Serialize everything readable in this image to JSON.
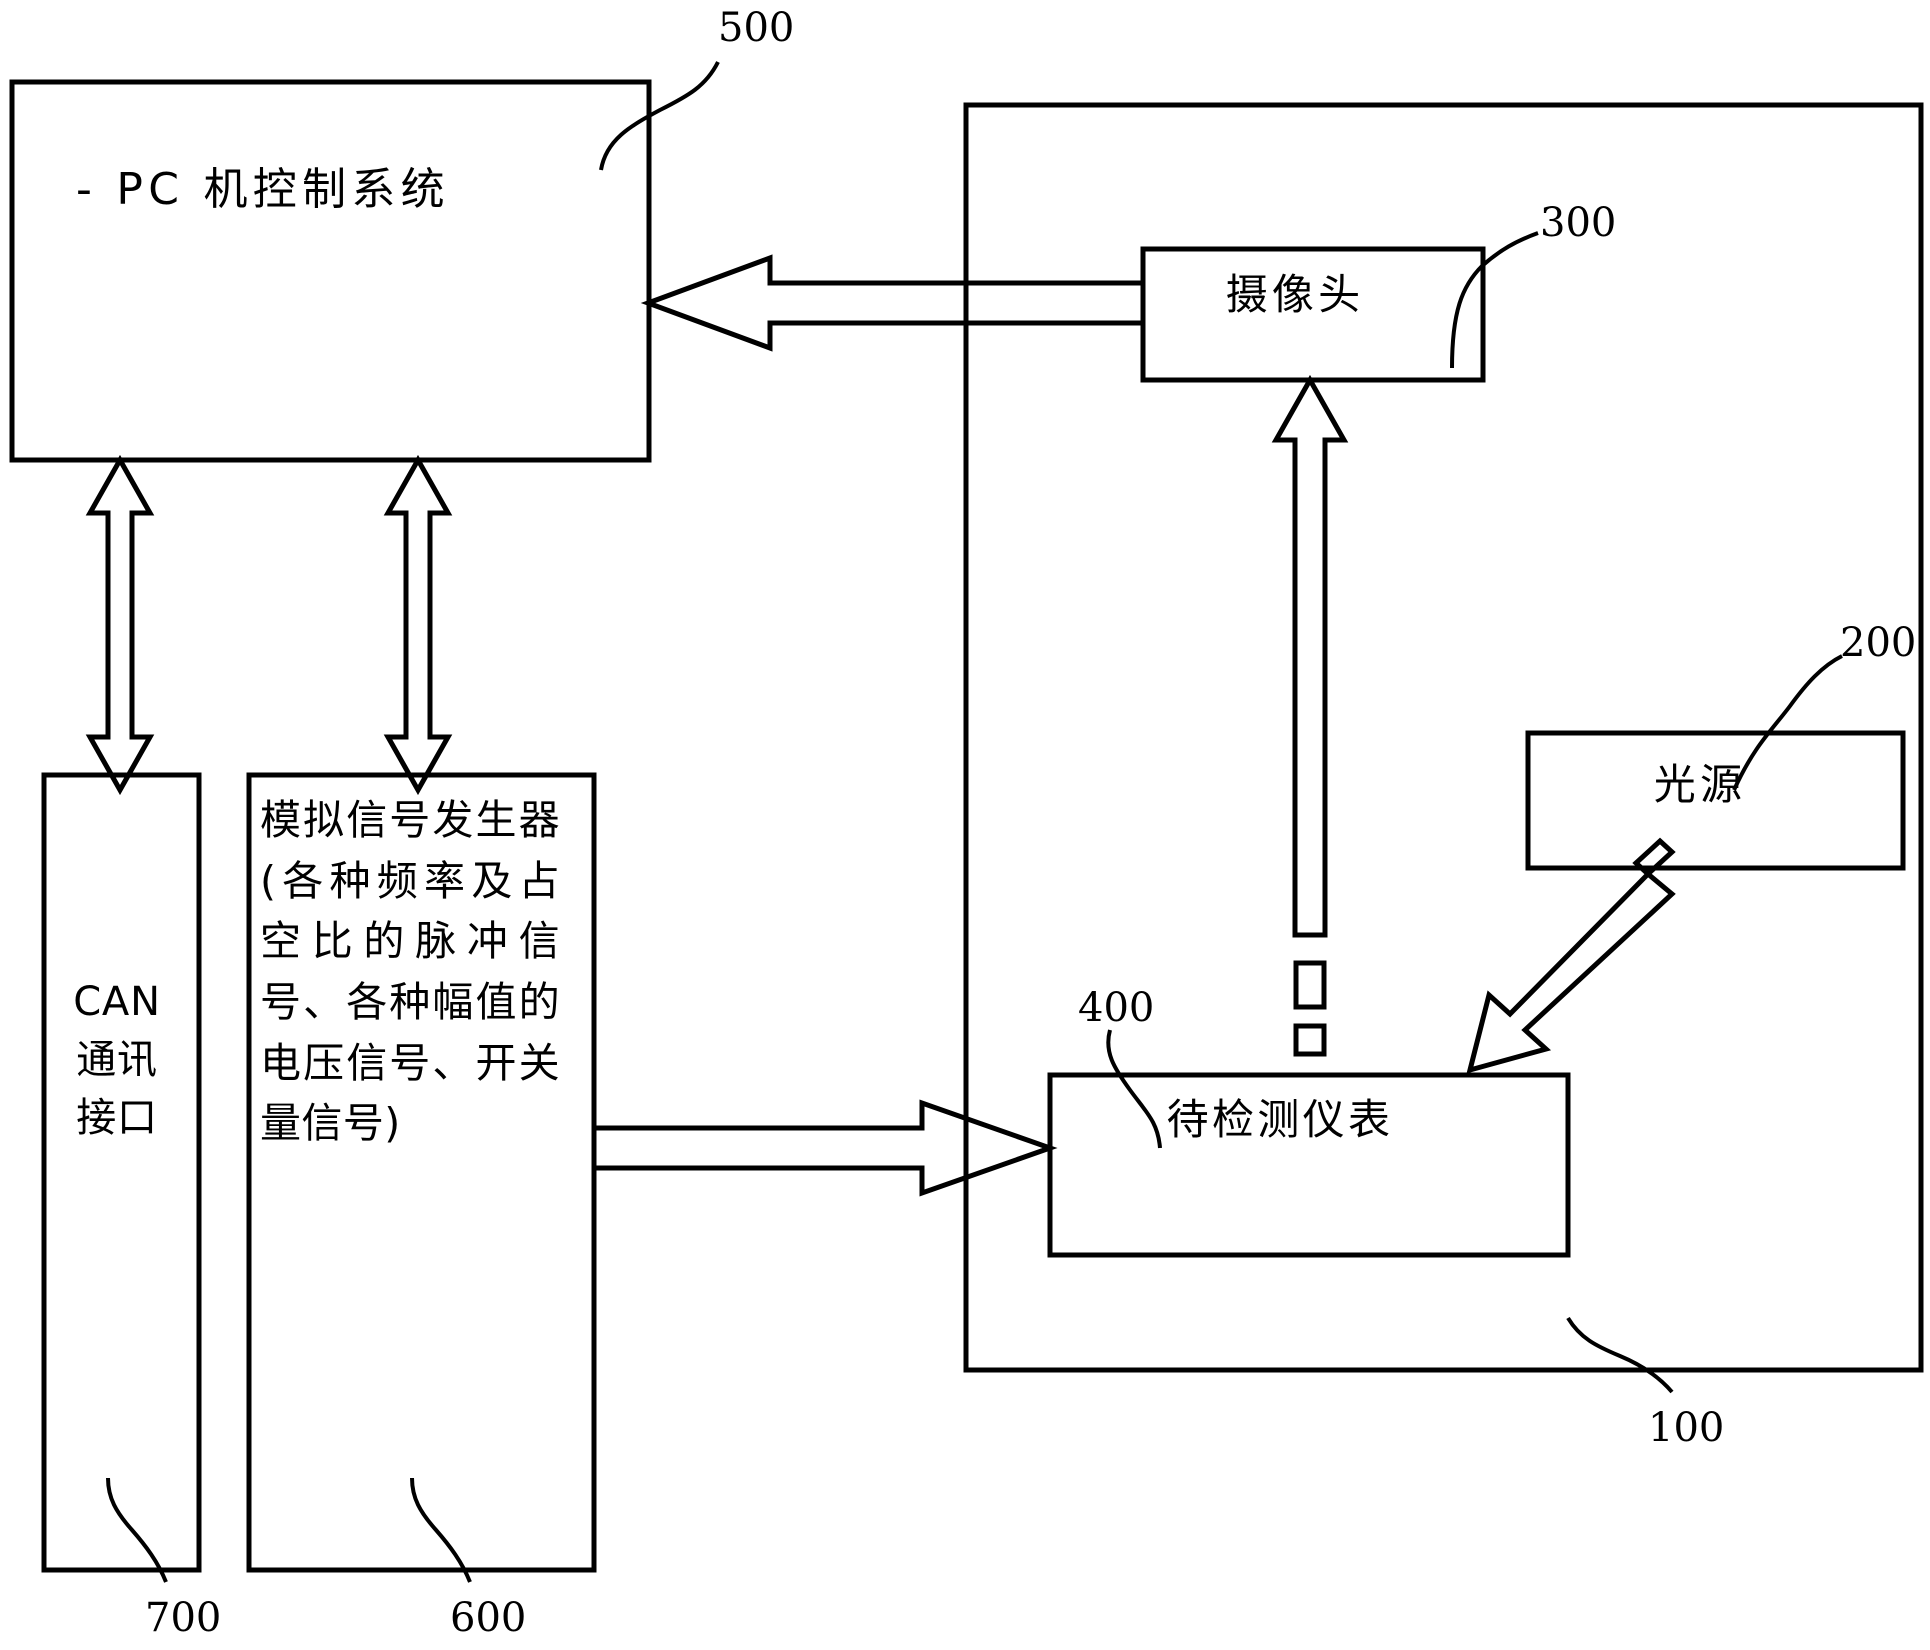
{
  "figure": {
    "type": "patent-block-diagram",
    "background_color": "#ffffff",
    "line_color": "#000000"
  },
  "blocks": {
    "pc_control_system": {
      "label": "- PC 机控制系统",
      "ref": "500"
    },
    "can_interface": {
      "line1": "CAN",
      "line2": "通讯",
      "line3": "接口",
      "ref": "700"
    },
    "signal_generator": {
      "label": "模拟信号发生器(各种频率及占空比的脉冲信号、各种幅值的电压信号、开关量信号)",
      "ref": "600"
    },
    "camera": {
      "label": "摄像头",
      "ref": "300"
    },
    "light_source": {
      "label": "光源",
      "ref": "200"
    },
    "meter_under_test": {
      "label": "待检测仪表",
      "ref": "400"
    },
    "enclosure": {
      "label": "",
      "ref": "100"
    }
  },
  "reference_numerals": [
    {
      "name": "pc-control-system",
      "value": "500"
    },
    {
      "name": "camera",
      "value": "300"
    },
    {
      "name": "light-source",
      "value": "200"
    },
    {
      "name": "meter-under-test",
      "value": "400"
    },
    {
      "name": "enclosure",
      "value": "100"
    },
    {
      "name": "can-interface",
      "value": "700"
    },
    {
      "name": "signal-generator",
      "value": "600"
    }
  ],
  "connectors": [
    {
      "name": "camera-to-pc",
      "direction": "left",
      "style": "hollow-arrow"
    },
    {
      "name": "pc-to-can",
      "direction": "bidirectional-vertical",
      "style": "hollow-double-arrow"
    },
    {
      "name": "pc-to-signal-generator",
      "direction": "bidirectional-vertical",
      "style": "hollow-double-arrow"
    },
    {
      "name": "meter-to-camera",
      "direction": "up",
      "style": "hollow-arrow"
    },
    {
      "name": "signal-generator-to-meter",
      "direction": "right",
      "style": "hollow-arrow"
    },
    {
      "name": "light-source-to-meter",
      "direction": "down-left",
      "style": "hollow-arrow"
    }
  ]
}
